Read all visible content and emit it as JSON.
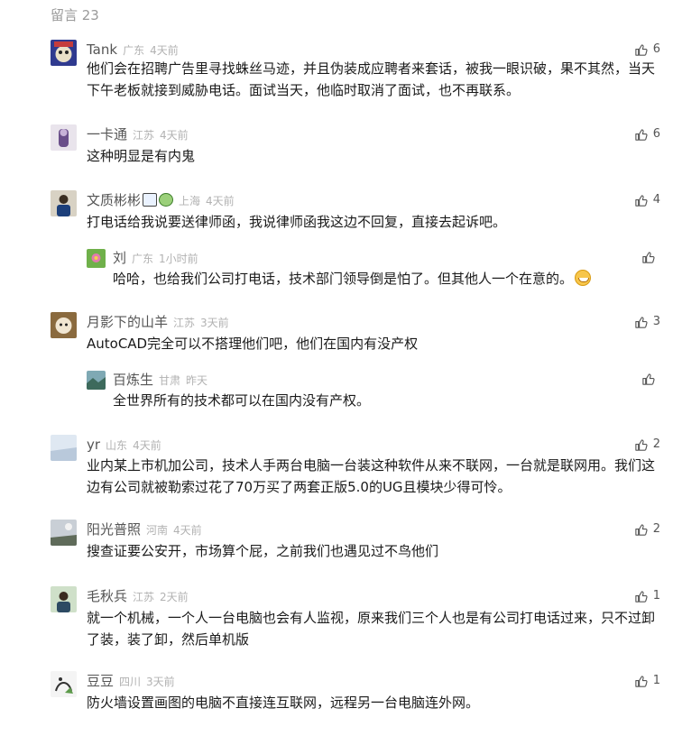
{
  "header": {
    "title": "留言 23"
  },
  "comments": [
    {
      "name": "Tank",
      "region": "广东",
      "time": "4天前",
      "likes": "6",
      "text_line1": "他们会在招聘广告里寻找蛛丝马迹，并且伪装成应聘者来套话，被我一眼识破，果不其然，当天",
      "text_line2": "下午老板就接到威胁电话。面试当天，他临时取消了面试，也不再联系。"
    },
    {
      "name": "一卡通",
      "region": "江苏",
      "time": "4天前",
      "likes": "6",
      "text_line1": "这种明显是有内鬼"
    },
    {
      "name": "文质彬彬",
      "region": "上海",
      "time": "4天前",
      "likes": "4",
      "text_line1": "打电话给我说要送律师函，我说律师函我这边不回复，直接去起诉吧。",
      "reply": {
        "name": "刘",
        "region": "广东",
        "time": "1小时前",
        "likes": "",
        "text_line1": "哈哈，也给我们公司打电话，技术部门领导倒是怕了。但其他人一个在意的。"
      }
    },
    {
      "name": "月影下的山羊",
      "region": "江苏",
      "time": "3天前",
      "likes": "3",
      "text_line1": "AutoCAD完全可以不搭理他们吧，他们在国内有没产权",
      "reply": {
        "name": "百炼生",
        "region": "甘肃",
        "time": "昨天",
        "likes": "",
        "text_line1": "全世界所有的技术都可以在国内没有产权。"
      }
    },
    {
      "name": "yr",
      "region": "山东",
      "time": "4天前",
      "likes": "2",
      "text_line1": "业内某上市机加公司，技术人手两台电脑一台装这种软件从来不联网，一台就是联网用。我们这",
      "text_line2": "边有公司就被勒索过花了70万买了两套正版5.0的UG且模块少得可怜。"
    },
    {
      "name": "阳光普照",
      "region": "河南",
      "time": "4天前",
      "likes": "2",
      "text_line1": "搜查证要公安开，市场算个屁，之前我们也遇见过不鸟他们"
    },
    {
      "name": "毛秋兵",
      "region": "江苏",
      "time": "2天前",
      "likes": "1",
      "text_line1": "就一个机械，一个人一台电脑也会有人监视，原来我们三个人也是有公司打电话过来，只不过卸",
      "text_line2": "了装，装了卸，然后单机版"
    },
    {
      "name": "豆豆",
      "region": "四川",
      "time": "3天前",
      "likes": "1",
      "text_line1": "防火墙设置画图的电脑不直接连互联网，远程另一台电脑连外网。"
    }
  ],
  "colors": {
    "nick": "#555555",
    "meta": "#b2b2b2",
    "text": "#1a1a1a",
    "header": "#9a9a9a"
  },
  "icons": {
    "like": "thumb-up-icon"
  }
}
